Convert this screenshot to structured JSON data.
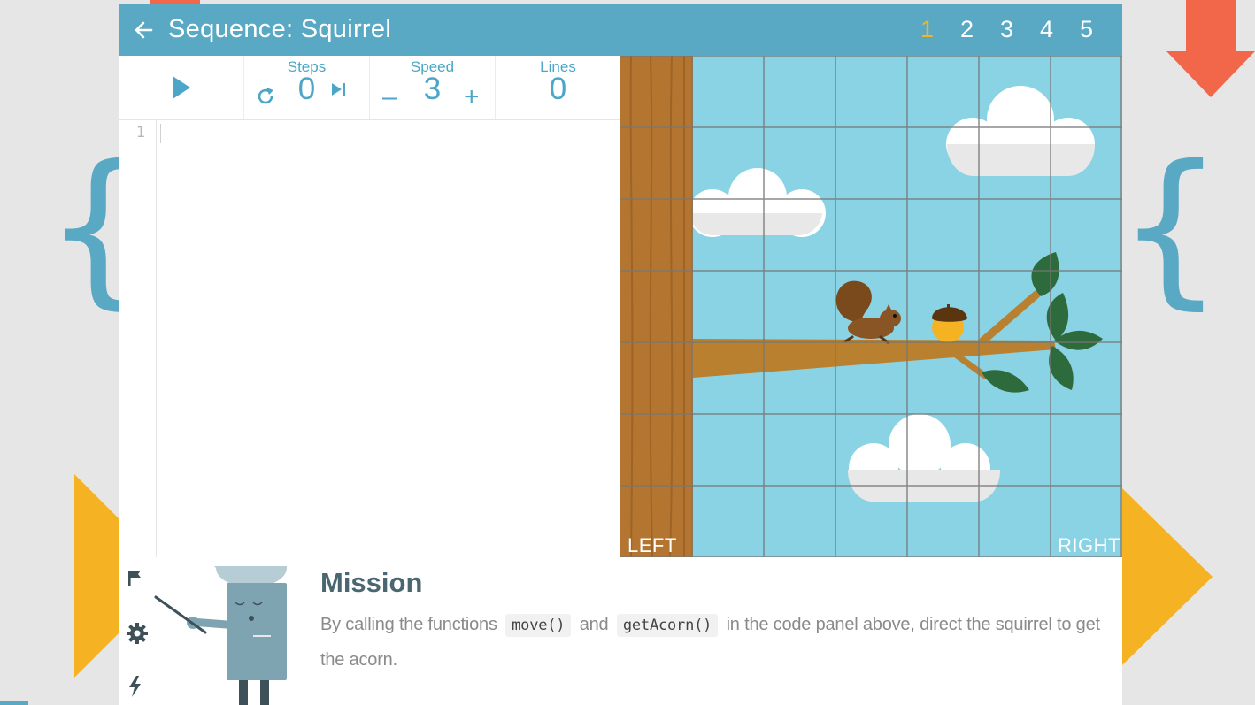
{
  "header": {
    "title": "Sequence: Squirrel",
    "levels": [
      "1",
      "2",
      "3",
      "4",
      "5"
    ],
    "active_level": "1"
  },
  "controls": {
    "steps_label": "Steps",
    "steps_value": "0",
    "speed_label": "Speed",
    "speed_value": "3",
    "speed_decrease": "–",
    "speed_increase": "+",
    "lines_label": "Lines",
    "lines_value": "0"
  },
  "editor": {
    "line_numbers": [
      "1"
    ],
    "code": ""
  },
  "stage": {
    "left_label": "LEFT",
    "right_label": "RIGHT"
  },
  "mission": {
    "title": "Mission",
    "text_part1": "By calling the functions",
    "code1": "move()",
    "text_part2": "and",
    "code2": "getAcorn()",
    "text_part3": "in the code panel above, direct the squirrel to get the acorn."
  },
  "colors": {
    "header_bg": "#5aa9c4",
    "accent_blue": "#4ba6c7",
    "active_level": "#f5b324",
    "sky": "#8ad3e4",
    "arrow_orange": "#f2664a",
    "triangle_yellow": "#f5b324"
  },
  "icons": {
    "back": "arrow-left-icon",
    "play": "play-icon",
    "reset": "reset-icon",
    "step": "step-forward-icon",
    "flag": "flag-icon",
    "settings": "gear-icon",
    "hint": "lightning-icon"
  }
}
